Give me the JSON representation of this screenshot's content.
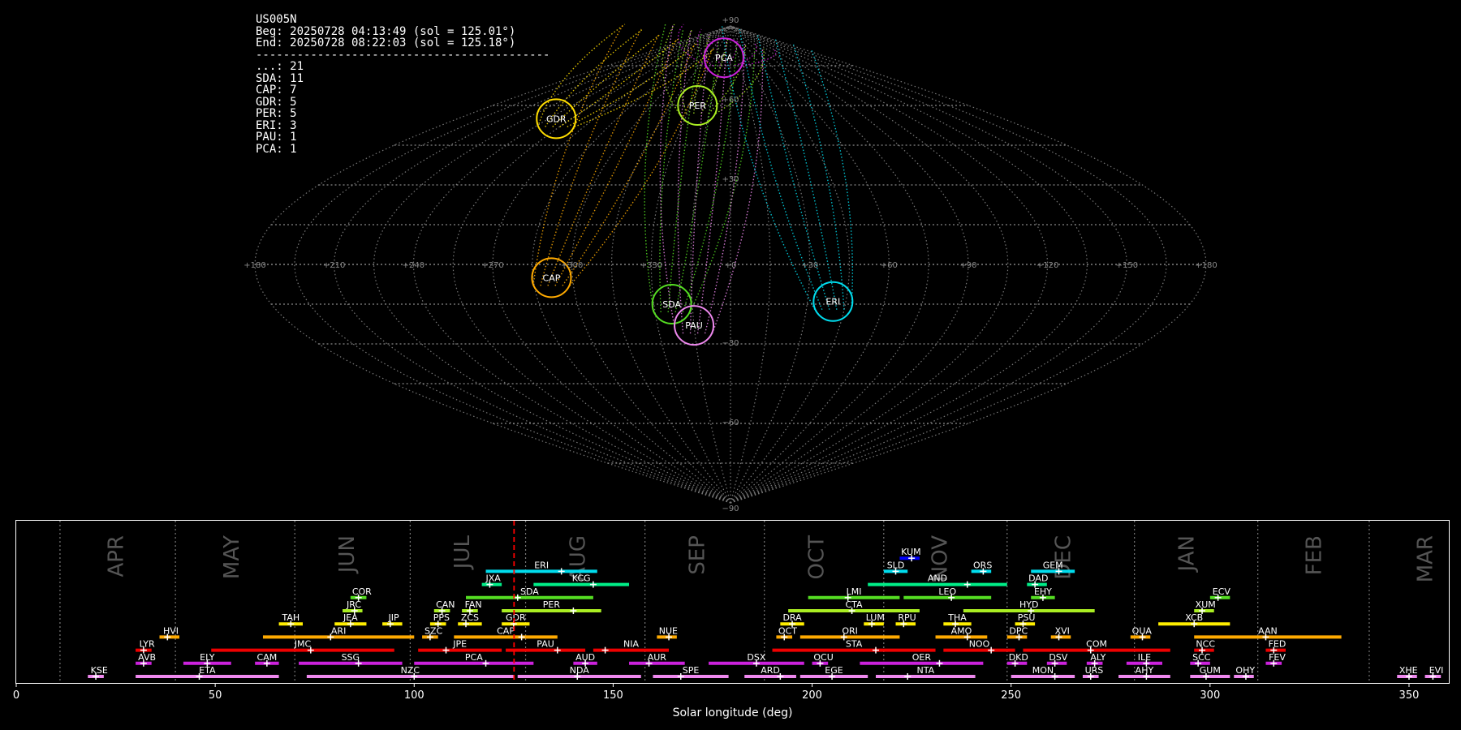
{
  "info": {
    "station": "US005N",
    "begin": "Beg: 20250728 04:13:49 (sol = 125.01°)",
    "end": "End: 20250728 08:22:03 (sol = 125.18°)",
    "separator": "-------------------------------------------",
    "counts": [
      {
        "code": "...",
        "n": 21
      },
      {
        "code": "SDA",
        "n": 11
      },
      {
        "code": "CAP",
        "n": 7
      },
      {
        "code": "GDR",
        "n": 5
      },
      {
        "code": "PER",
        "n": 5
      },
      {
        "code": "ERI",
        "n": 3
      },
      {
        "code": "PAU",
        "n": 1
      },
      {
        "code": "PCA",
        "n": 1
      }
    ]
  },
  "chart_data": [
    {
      "type": "scatter",
      "projection": "sinusoidal",
      "lon_ticks": [
        "+180",
        "+150",
        "+120",
        "+90",
        "+60",
        "+30",
        "+0",
        "+330",
        "+300",
        "+270",
        "+240",
        "+210",
        "+180"
      ],
      "lat_ticks": [
        "+90",
        "+60",
        "+30",
        "−30",
        "−60",
        "−90"
      ],
      "radiants": [
        {
          "code": "PCA",
          "lon": -12,
          "lat": 78,
          "color": "#cc22dd"
        },
        {
          "code": "PER",
          "lon": -25,
          "lat": 60,
          "color": "#aaee22"
        },
        {
          "code": "GDR",
          "lon": -115,
          "lat": 55,
          "color": "#ffdd00"
        },
        {
          "code": "CAP",
          "lon": -68,
          "lat": -5,
          "color": "#ffaa00"
        },
        {
          "code": "SDA",
          "lon": -23,
          "lat": -15,
          "color": "#55dd22"
        },
        {
          "code": "PAU",
          "lon": -15,
          "lat": -23,
          "color": "#ee88ee"
        },
        {
          "code": "ERI",
          "lon": 40,
          "lat": -14,
          "color": "#00ddee"
        }
      ]
    },
    {
      "type": "bar",
      "title": "",
      "xlabel": "Solar longitude (deg)",
      "xlim": [
        0,
        360
      ],
      "x_ticks": [
        0,
        50,
        100,
        150,
        200,
        250,
        300,
        350
      ],
      "current_sol": 125.1,
      "months": [
        {
          "label": "APR",
          "x": 25
        },
        {
          "label": "MAY",
          "x": 54
        },
        {
          "label": "JUN",
          "x": 83
        },
        {
          "label": "JUL",
          "x": 112
        },
        {
          "label": "AUG",
          "x": 141
        },
        {
          "label": "SEP",
          "x": 171
        },
        {
          "label": "OCT",
          "x": 201
        },
        {
          "label": "NOV",
          "x": 232
        },
        {
          "label": "DEC",
          "x": 263
        },
        {
          "label": "JAN",
          "x": 294
        },
        {
          "label": "FEB",
          "x": 326
        },
        {
          "label": "MAR",
          "x": 354
        }
      ],
      "month_boundaries": [
        11,
        40,
        70,
        99,
        128,
        158,
        188,
        218,
        249,
        281,
        312,
        340
      ],
      "showers": [
        {
          "code": "KUM",
          "start": 222,
          "end": 227,
          "peak": 225,
          "row": 10,
          "color": "#0000ff"
        },
        {
          "code": "ERI",
          "start": 118,
          "end": 146,
          "peak": 137,
          "row": 9,
          "color": "#00ddee"
        },
        {
          "code": "SLD",
          "start": 218,
          "end": 224,
          "peak": 221,
          "row": 9,
          "color": "#00ddee"
        },
        {
          "code": "ORS",
          "start": 240,
          "end": 245,
          "peak": 243,
          "row": 9,
          "color": "#00ddee"
        },
        {
          "code": "GEM",
          "start": 255,
          "end": 266,
          "peak": 262,
          "row": 9,
          "color": "#00ddee"
        },
        {
          "code": "JXA",
          "start": 117,
          "end": 122,
          "peak": 119,
          "row": 8,
          "color": "#00ee88"
        },
        {
          "code": "KCG",
          "start": 130,
          "end": 154,
          "peak": 145,
          "row": 8,
          "color": "#00ee88"
        },
        {
          "code": "AND",
          "start": 214,
          "end": 249,
          "peak": 239,
          "row": 8,
          "color": "#00ee88"
        },
        {
          "code": "DAD",
          "start": 254,
          "end": 259,
          "peak": 256,
          "row": 8,
          "color": "#00ee88"
        },
        {
          "code": "COR",
          "start": 84,
          "end": 88,
          "peak": 86,
          "row": 7,
          "color": "#55dd22"
        },
        {
          "code": "SDA",
          "start": 113,
          "end": 145,
          "peak": 126,
          "row": 7,
          "color": "#55dd22"
        },
        {
          "code": "LMI",
          "start": 199,
          "end": 222,
          "peak": 209,
          "row": 7,
          "color": "#55dd22"
        },
        {
          "code": "LEO",
          "start": 223,
          "end": 245,
          "peak": 235,
          "row": 7,
          "color": "#55dd22"
        },
        {
          "code": "EHY",
          "start": 255,
          "end": 261,
          "peak": 258,
          "row": 7,
          "color": "#55dd22"
        },
        {
          "code": "ECV",
          "start": 300,
          "end": 305,
          "peak": 302,
          "row": 7,
          "color": "#55dd22"
        },
        {
          "code": "JRC",
          "start": 82,
          "end": 87,
          "peak": 85,
          "row": 6,
          "color": "#aaee22"
        },
        {
          "code": "CAN",
          "start": 105,
          "end": 109,
          "peak": 107,
          "row": 6,
          "color": "#aaee22"
        },
        {
          "code": "FAN",
          "start": 112,
          "end": 116,
          "peak": 114,
          "row": 6,
          "color": "#aaee22"
        },
        {
          "code": "PER",
          "start": 122,
          "end": 147,
          "peak": 140,
          "row": 6,
          "color": "#aaee22"
        },
        {
          "code": "CTA",
          "start": 194,
          "end": 227,
          "peak": 210,
          "row": 6,
          "color": "#aaee22"
        },
        {
          "code": "HYD",
          "start": 238,
          "end": 271,
          "peak": 255,
          "row": 6,
          "color": "#aaee22"
        },
        {
          "code": "XUM",
          "start": 296,
          "end": 301,
          "peak": 298,
          "row": 6,
          "color": "#aaee22"
        },
        {
          "code": "TAH",
          "start": 66,
          "end": 72,
          "peak": 69,
          "row": 5,
          "color": "#ffee00"
        },
        {
          "code": "JEA",
          "start": 80,
          "end": 88,
          "peak": 84,
          "row": 5,
          "color": "#ffee00"
        },
        {
          "code": "JIP",
          "start": 92,
          "end": 97,
          "peak": 94,
          "row": 5,
          "color": "#ffee00"
        },
        {
          "code": "PPS",
          "start": 104,
          "end": 108,
          "peak": 106,
          "row": 5,
          "color": "#ffee00"
        },
        {
          "code": "ZCS",
          "start": 111,
          "end": 117,
          "peak": 113,
          "row": 5,
          "color": "#ffee00"
        },
        {
          "code": "GDR",
          "start": 122,
          "end": 129,
          "peak": 125,
          "row": 5,
          "color": "#ffee00"
        },
        {
          "code": "DRA",
          "start": 192,
          "end": 198,
          "peak": 195,
          "row": 5,
          "color": "#ffee00"
        },
        {
          "code": "LUM",
          "start": 213,
          "end": 218,
          "peak": 215,
          "row": 5,
          "color": "#ffee00"
        },
        {
          "code": "RPU",
          "start": 221,
          "end": 226,
          "peak": 223,
          "row": 5,
          "color": "#ffee00"
        },
        {
          "code": "THA",
          "start": 233,
          "end": 240,
          "peak": 236,
          "row": 5,
          "color": "#ffee00"
        },
        {
          "code": "PSU",
          "start": 251,
          "end": 256,
          "peak": 253,
          "row": 5,
          "color": "#ffee00"
        },
        {
          "code": "XCB",
          "start": 287,
          "end": 305,
          "peak": 296,
          "row": 5,
          "color": "#ffee00"
        },
        {
          "code": "HVI",
          "start": 36,
          "end": 41,
          "peak": 38,
          "row": 4,
          "color": "#ffaa00"
        },
        {
          "code": "ARI",
          "start": 62,
          "end": 100,
          "peak": 79,
          "row": 4,
          "color": "#ffaa00"
        },
        {
          "code": "SZC",
          "start": 102,
          "end": 106,
          "peak": 104,
          "row": 4,
          "color": "#ffaa00"
        },
        {
          "code": "CAP",
          "start": 110,
          "end": 136,
          "peak": 127,
          "row": 4,
          "color": "#ffaa00"
        },
        {
          "code": "NUE",
          "start": 161,
          "end": 166,
          "peak": 164,
          "row": 4,
          "color": "#ffaa00"
        },
        {
          "code": "OCT",
          "start": 191,
          "end": 195,
          "peak": 193,
          "row": 4,
          "color": "#ffaa00"
        },
        {
          "code": "ORI",
          "start": 197,
          "end": 222,
          "peak": 208,
          "row": 4,
          "color": "#ffaa00"
        },
        {
          "code": "AMO",
          "start": 231,
          "end": 244,
          "peak": 239,
          "row": 4,
          "color": "#ffaa00"
        },
        {
          "code": "DPC",
          "start": 249,
          "end": 254,
          "peak": 252,
          "row": 4,
          "color": "#ffaa00"
        },
        {
          "code": "XVI",
          "start": 260,
          "end": 265,
          "peak": 262,
          "row": 4,
          "color": "#ffaa00"
        },
        {
          "code": "QUA",
          "start": 280,
          "end": 285,
          "peak": 283,
          "row": 4,
          "color": "#ffaa00"
        },
        {
          "code": "AAN",
          "start": 296,
          "end": 333,
          "peak": 314,
          "row": 4,
          "color": "#ffaa00"
        },
        {
          "code": "LYR",
          "start": 30,
          "end": 34,
          "peak": 32,
          "row": 3,
          "color": "#ee0000"
        },
        {
          "code": "JMC",
          "start": 49,
          "end": 95,
          "peak": 74,
          "row": 3,
          "color": "#ee0000"
        },
        {
          "code": "JPE",
          "start": 101,
          "end": 122,
          "peak": 108,
          "row": 3,
          "color": "#ee0000"
        },
        {
          "code": "PAU",
          "start": 123,
          "end": 143,
          "peak": 136,
          "row": 3,
          "color": "#ee0000"
        },
        {
          "code": "NIA",
          "start": 145,
          "end": 164,
          "peak": 148,
          "row": 3,
          "color": "#ee0000"
        },
        {
          "code": "STA",
          "start": 190,
          "end": 231,
          "peak": 216,
          "row": 3,
          "color": "#ee0000"
        },
        {
          "code": "NOO",
          "start": 233,
          "end": 251,
          "peak": 245,
          "row": 3,
          "color": "#ee0000"
        },
        {
          "code": "COM",
          "start": 253,
          "end": 290,
          "peak": 270,
          "row": 3,
          "color": "#ee0000"
        },
        {
          "code": "NCC",
          "start": 296,
          "end": 301,
          "peak": 298,
          "row": 3,
          "color": "#ee0000"
        },
        {
          "code": "FED",
          "start": 314,
          "end": 319,
          "peak": 316,
          "row": 3,
          "color": "#ee0000"
        },
        {
          "code": "AVB",
          "start": 30,
          "end": 34,
          "peak": 32,
          "row": 2,
          "color": "#cc22dd"
        },
        {
          "code": "ELY",
          "start": 42,
          "end": 54,
          "peak": 48,
          "row": 2,
          "color": "#cc22dd"
        },
        {
          "code": "CAM",
          "start": 60,
          "end": 66,
          "peak": 63,
          "row": 2,
          "color": "#cc22dd"
        },
        {
          "code": "SSG",
          "start": 71,
          "end": 97,
          "peak": 86,
          "row": 2,
          "color": "#cc22dd"
        },
        {
          "code": "PCA",
          "start": 100,
          "end": 130,
          "peak": 118,
          "row": 2,
          "color": "#cc22dd"
        },
        {
          "code": "AUD",
          "start": 140,
          "end": 146,
          "peak": 143,
          "row": 2,
          "color": "#cc22dd"
        },
        {
          "code": "AUR",
          "start": 154,
          "end": 168,
          "peak": 159,
          "row": 2,
          "color": "#cc22dd"
        },
        {
          "code": "DSX",
          "start": 174,
          "end": 198,
          "peak": 186,
          "row": 2,
          "color": "#cc22dd"
        },
        {
          "code": "OCU",
          "start": 200,
          "end": 204,
          "peak": 202,
          "row": 2,
          "color": "#cc22dd"
        },
        {
          "code": "OER",
          "start": 212,
          "end": 243,
          "peak": 232,
          "row": 2,
          "color": "#cc22dd"
        },
        {
          "code": "DKD",
          "start": 249,
          "end": 254,
          "peak": 251,
          "row": 2,
          "color": "#cc22dd"
        },
        {
          "code": "DSV",
          "start": 259,
          "end": 264,
          "peak": 261,
          "row": 2,
          "color": "#cc22dd"
        },
        {
          "code": "ALY",
          "start": 269,
          "end": 273,
          "peak": 271,
          "row": 2,
          "color": "#cc22dd"
        },
        {
          "code": "ILE",
          "start": 279,
          "end": 288,
          "peak": 284,
          "row": 2,
          "color": "#cc22dd"
        },
        {
          "code": "SCC",
          "start": 295,
          "end": 300,
          "peak": 297,
          "row": 2,
          "color": "#cc22dd"
        },
        {
          "code": "FEV",
          "start": 314,
          "end": 318,
          "peak": 316,
          "row": 2,
          "color": "#cc22dd"
        },
        {
          "code": "KSE",
          "start": 18,
          "end": 22,
          "peak": 20,
          "row": 1,
          "color": "#ee88ee"
        },
        {
          "code": "ETA",
          "start": 30,
          "end": 66,
          "peak": 46,
          "row": 1,
          "color": "#ee88ee"
        },
        {
          "code": "NZC",
          "start": 73,
          "end": 125,
          "peak": 100,
          "row": 1,
          "color": "#ee88ee"
        },
        {
          "code": "NDA",
          "start": 126,
          "end": 157,
          "peak": 141,
          "row": 1,
          "color": "#ee88ee"
        },
        {
          "code": "SPE",
          "start": 160,
          "end": 179,
          "peak": 167,
          "row": 1,
          "color": "#ee88ee"
        },
        {
          "code": "ARD",
          "start": 183,
          "end": 196,
          "peak": 192,
          "row": 1,
          "color": "#ee88ee"
        },
        {
          "code": "EGE",
          "start": 197,
          "end": 214,
          "peak": 205,
          "row": 1,
          "color": "#ee88ee"
        },
        {
          "code": "NTA",
          "start": 216,
          "end": 241,
          "peak": 224,
          "row": 1,
          "color": "#ee88ee"
        },
        {
          "code": "MON",
          "start": 250,
          "end": 266,
          "peak": 261,
          "row": 1,
          "color": "#ee88ee"
        },
        {
          "code": "URS",
          "start": 268,
          "end": 272,
          "peak": 270,
          "row": 1,
          "color": "#ee88ee"
        },
        {
          "code": "AHY",
          "start": 277,
          "end": 290,
          "peak": 284,
          "row": 1,
          "color": "#ee88ee"
        },
        {
          "code": "GUM",
          "start": 295,
          "end": 305,
          "peak": 299,
          "row": 1,
          "color": "#ee88ee"
        },
        {
          "code": "OHY",
          "start": 306,
          "end": 311,
          "peak": 309,
          "row": 1,
          "color": "#ee88ee"
        },
        {
          "code": "XHE",
          "start": 347,
          "end": 352,
          "peak": 350,
          "row": 1,
          "color": "#ee88ee"
        },
        {
          "code": "EVI",
          "start": 354,
          "end": 358,
          "peak": 356,
          "row": 1,
          "color": "#ee88ee"
        }
      ]
    }
  ]
}
